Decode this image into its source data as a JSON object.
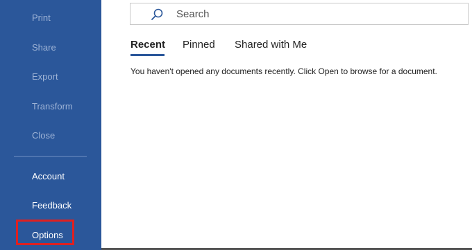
{
  "sidebar": {
    "items_dim": [
      "Print",
      "Share",
      "Export",
      "Transform",
      "Close"
    ],
    "items_bright": [
      "Account",
      "Feedback",
      "Options"
    ]
  },
  "search": {
    "placeholder": "Search",
    "icon": "search-icon"
  },
  "tabs": [
    "Recent",
    "Pinned",
    "Shared with Me"
  ],
  "active_tab": "Recent",
  "empty_message": "You haven't opened any documents recently. Click Open to browse for a document.",
  "colors": {
    "sidebar": "#2b579a",
    "accent": "#2b579a",
    "highlight": "#e02020"
  }
}
